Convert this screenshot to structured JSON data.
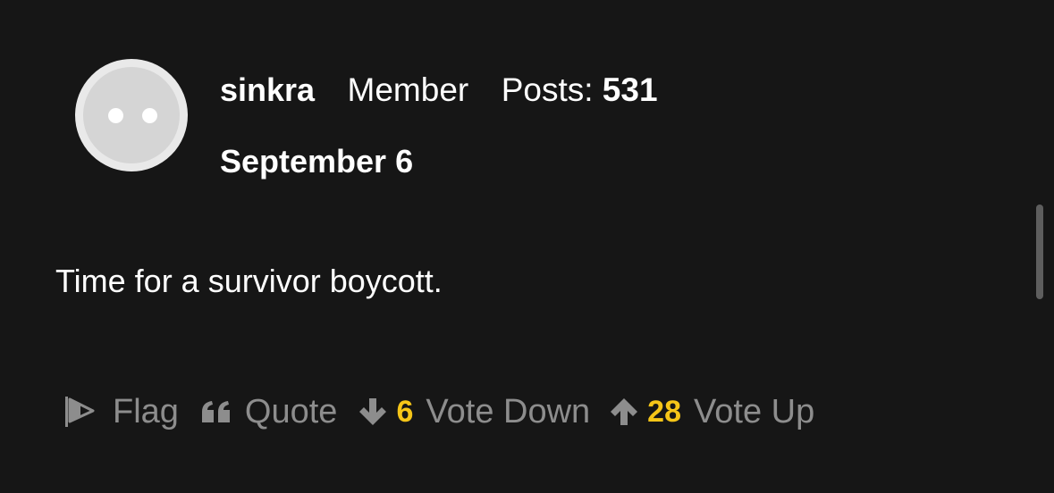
{
  "author": {
    "username": "sinkra",
    "role": "Member",
    "posts_label": "Posts:",
    "posts_count": "531"
  },
  "post": {
    "date": "September 6",
    "body": "Time for a survivor boycott."
  },
  "actions": {
    "flag_label": "Flag",
    "quote_label": "Quote",
    "vote_down_count": "6",
    "vote_down_label": "Vote Down",
    "vote_up_count": "28",
    "vote_up_label": "Vote Up"
  },
  "colors": {
    "background": "#161616",
    "text": "#ffffff",
    "muted": "#8d8d8d",
    "count_accent": "#f5c518"
  },
  "icons": {
    "flag": "flag-icon",
    "quote": "quote-icon",
    "vote_down": "arrow-down-icon",
    "vote_up": "arrow-up-icon"
  }
}
